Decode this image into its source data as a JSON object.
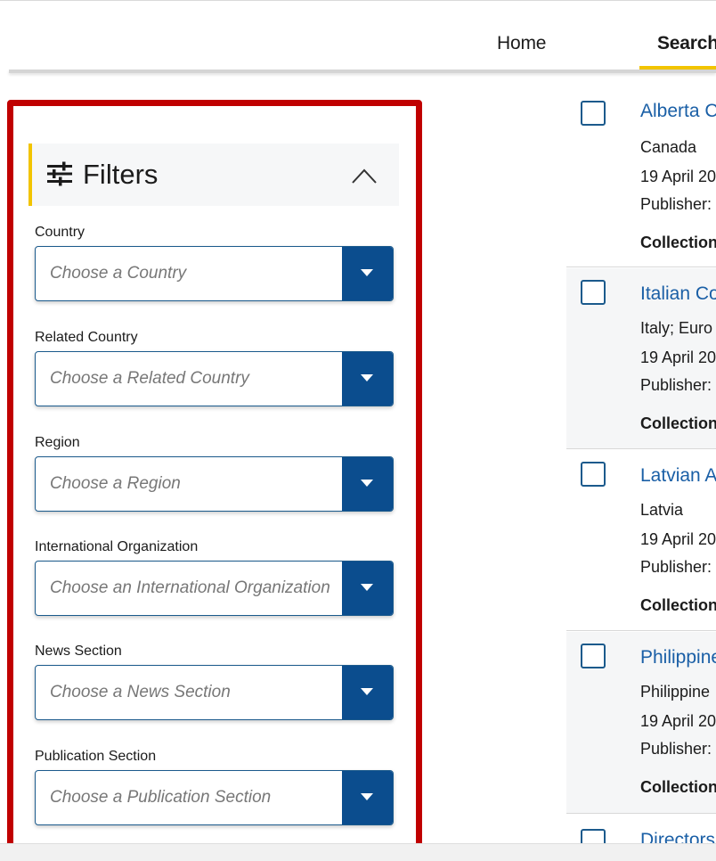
{
  "nav": {
    "home": "Home",
    "search": "Search",
    "active_color": "#f2c400"
  },
  "filters": {
    "title": "Filters",
    "icon": "sliders-icon",
    "toggle_icon": "chevron-up-icon",
    "fields": [
      {
        "label": "Country",
        "placeholder": "Choose a Country"
      },
      {
        "label": "Related Country",
        "placeholder": "Choose a Related Country"
      },
      {
        "label": "Region",
        "placeholder": "Choose a Region"
      },
      {
        "label": "International Organization",
        "placeholder": "Choose an International Organization"
      },
      {
        "label": "News Section",
        "placeholder": "Choose a News Section"
      },
      {
        "label": "Publication Section",
        "placeholder": "Choose a Publication Section"
      }
    ]
  },
  "results": [
    {
      "title": "Alberta C",
      "country": "Canada",
      "date": "19 April 20",
      "publisher": "Publisher:",
      "collection": "Collection"
    },
    {
      "title": "Italian Co",
      "country": "Italy; Euro",
      "date": "19 April 20",
      "publisher": "Publisher:",
      "collection": "Collection"
    },
    {
      "title": "Latvian A",
      "country": "Latvia",
      "date": "19 April 20",
      "publisher": "Publisher:",
      "collection": "Collection"
    },
    {
      "title": "Philippine",
      "country": "Philippine",
      "date": "19 April 20",
      "publisher": "Publisher:",
      "collection": "Collection"
    },
    {
      "title": "Directors",
      "country": "",
      "date": "",
      "publisher": "",
      "collection": ""
    }
  ],
  "colors": {
    "highlight": "#c00000",
    "select_button": "#0b4d8e",
    "link": "#1a5fa6"
  }
}
